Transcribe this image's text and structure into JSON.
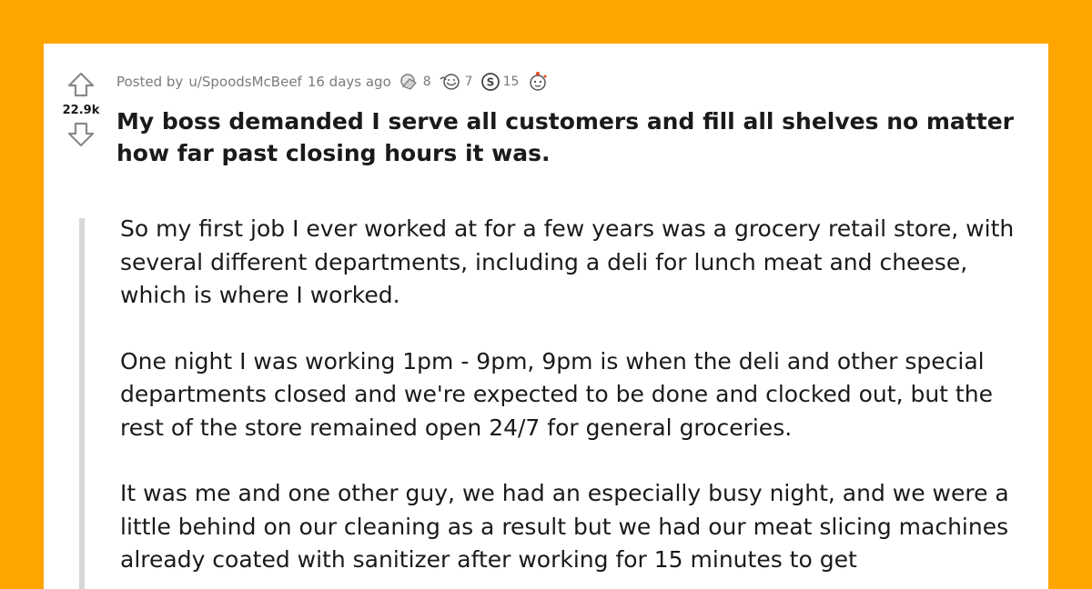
{
  "post": {
    "score": "22.9k",
    "posted_by_prefix": "Posted by",
    "author": "u/SpoodsMcBeef",
    "time_ago": "16 days ago",
    "awards": [
      {
        "icon": "silver-award-icon",
        "count": "8"
      },
      {
        "icon": "wholesome-award-icon",
        "count": "7"
      },
      {
        "icon": "gold-coin-award-icon",
        "count": "15"
      },
      {
        "icon": "helpful-award-icon",
        "count": ""
      }
    ],
    "title": "My boss demanded I serve all customers and fill all shelves no matter how far past closing hours it was.",
    "paragraphs": [
      "So my first job I ever worked at for a few years was a grocery retail store, with several different departments, including a deli for lunch meat and cheese, which is where I worked.",
      "One night I was working 1pm - 9pm, 9pm is when the deli and other special departments closed and we're expected to be done and clocked out, but the rest of the store remained open 24/7 for general groceries.",
      "It was me and one other guy, we had an especially busy night, and we were a little behind on our cleaning as a result but we had our meat slicing machines already coated with sanitizer after working for 15 minutes to get"
    ]
  },
  "colors": {
    "background": "#FFA500",
    "card": "#ffffff",
    "text": "#1a1a1b",
    "meta": "#787c7e",
    "quote_bar": "#d7d7d7"
  }
}
